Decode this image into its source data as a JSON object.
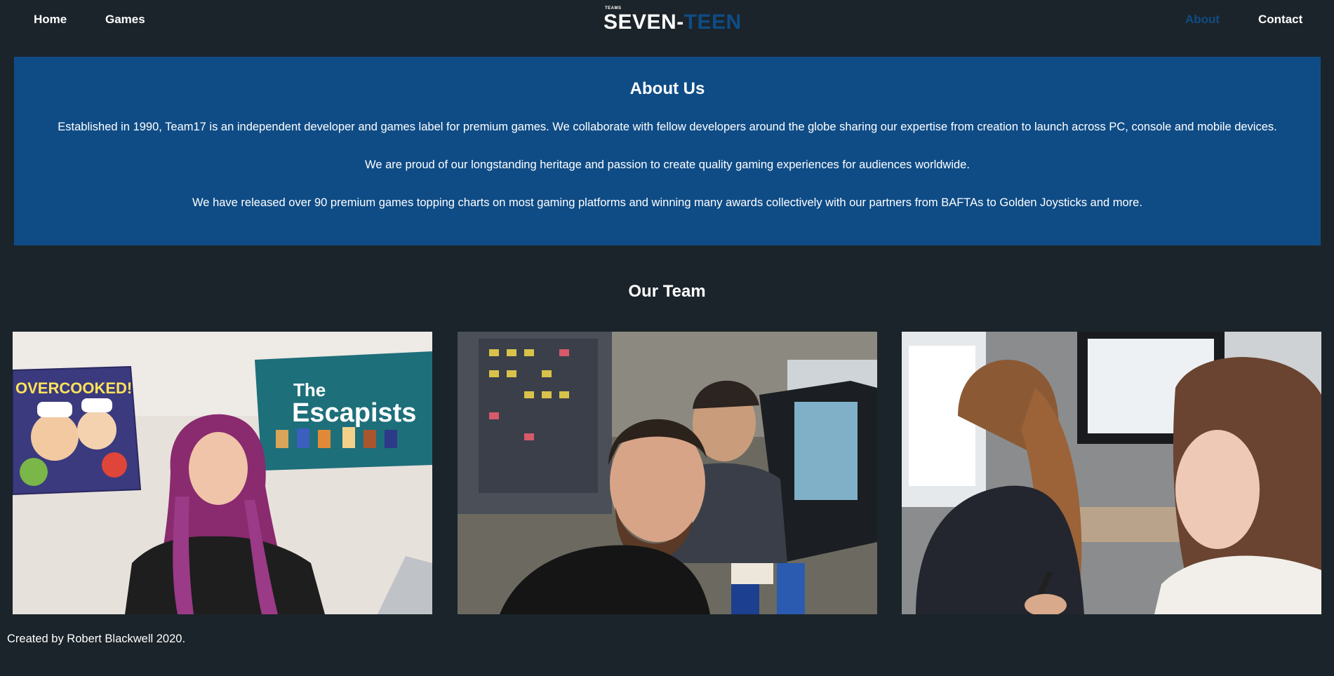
{
  "nav": {
    "home": "Home",
    "games": "Games",
    "about": "About",
    "contact": "Contact"
  },
  "logo": {
    "small": "TEAMS",
    "part1": "SEVEN-",
    "part2": "TEEN"
  },
  "about": {
    "title": "About Us",
    "paragraphs": [
      "Established in 1990, Team17 is an independent developer and games label for premium games. We collaborate with fellow developers around the globe sharing our expertise from creation to launch across PC, console and mobile devices.",
      "We are proud of our longstanding heritage and passion to create quality gaming experiences for audiences worldwide.",
      "We have released over 90 premium games topping charts on most gaming platforms and winning many awards collectively with our partners from BAFTAs to Golden Joysticks and more."
    ]
  },
  "team": {
    "title": "Our Team",
    "photo1": {
      "poster_left": "OVERCOOKED!",
      "poster_right_line1": "The",
      "poster_right_line2": "Escapists"
    }
  },
  "footer": {
    "text": "Created by Robert Blackwell 2020."
  },
  "colors": {
    "background": "#1b242a",
    "accent": "#0f4c86",
    "text": "#ffffff"
  }
}
